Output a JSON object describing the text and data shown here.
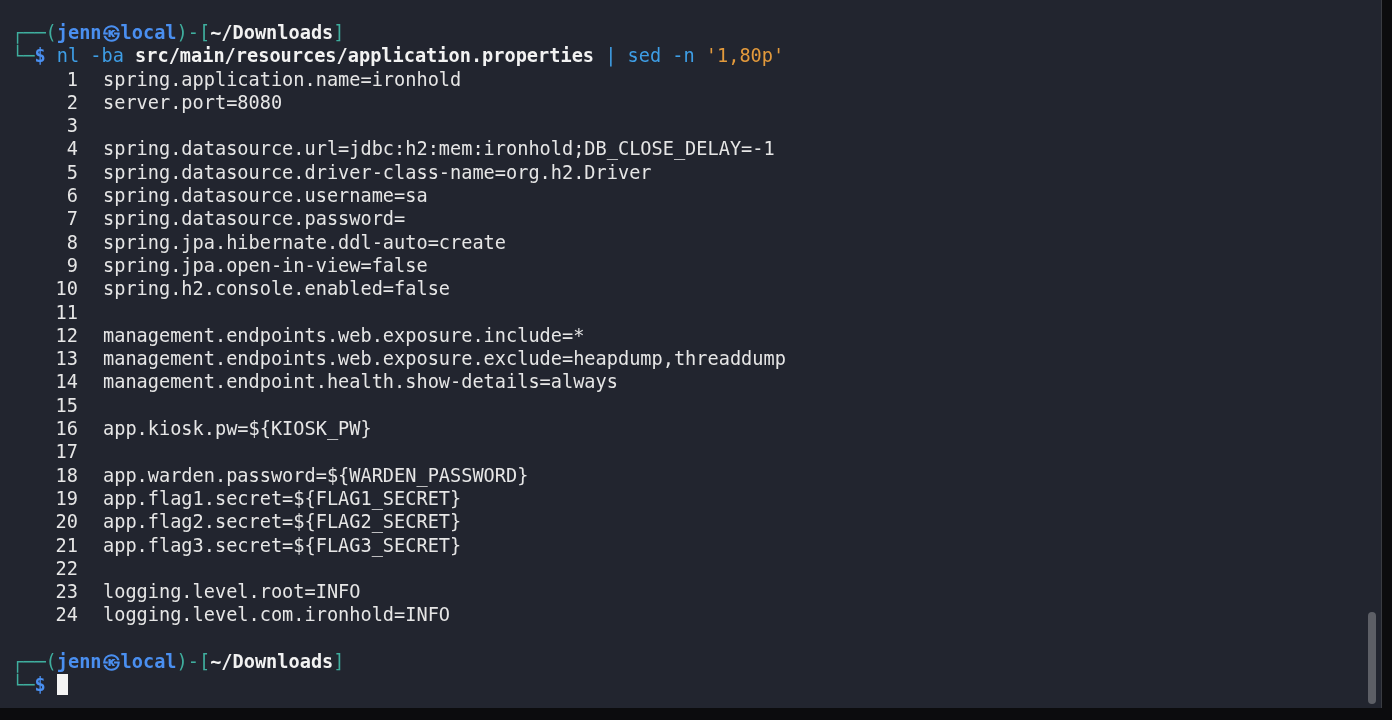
{
  "prompts": [
    {
      "open": "┌──(",
      "user": "jenn",
      "at": "㉿",
      "host": "local",
      "mid": ")-[",
      "path": "~/Downloads",
      "close": "]",
      "corner": "└─",
      "symbol": "$",
      "command": [
        {
          "kind": "cmd",
          "text": "nl"
        },
        {
          "kind": "flag",
          "text": "-ba"
        },
        {
          "kind": "path",
          "text": "src/main/resources/application.properties"
        },
        {
          "kind": "pipe",
          "text": "|"
        },
        {
          "kind": "cmd",
          "text": "sed"
        },
        {
          "kind": "flag",
          "text": "-n"
        },
        {
          "kind": "string",
          "text": "'1,80p'"
        }
      ]
    },
    {
      "open": "┌──(",
      "user": "jenn",
      "at": "㉿",
      "host": "local",
      "mid": ")-[",
      "path": "~/Downloads",
      "close": "]",
      "corner": "└─",
      "symbol": "$",
      "cursor": true
    }
  ],
  "output": [
    {
      "number": "1",
      "text": "spring.application.name=ironhold"
    },
    {
      "number": "2",
      "text": "server.port=8080"
    },
    {
      "number": "3"
    },
    {
      "number": "4",
      "text": "spring.datasource.url=jdbc:h2:mem:ironhold;DB_CLOSE_DELAY=-1"
    },
    {
      "number": "5",
      "text": "spring.datasource.driver-class-name=org.h2.Driver"
    },
    {
      "number": "6",
      "text": "spring.datasource.username=sa"
    },
    {
      "number": "7",
      "text": "spring.datasource.password="
    },
    {
      "number": "8",
      "text": "spring.jpa.hibernate.ddl-auto=create"
    },
    {
      "number": "9",
      "text": "spring.jpa.open-in-view=false"
    },
    {
      "number": "10",
      "text": "spring.h2.console.enabled=false"
    },
    {
      "number": "11"
    },
    {
      "number": "12",
      "text": "management.endpoints.web.exposure.include=*"
    },
    {
      "number": "13",
      "text": "management.endpoints.web.exposure.exclude=heapdump,threaddump"
    },
    {
      "number": "14",
      "text": "management.endpoint.health.show-details=always"
    },
    {
      "number": "15"
    },
    {
      "number": "16",
      "text": "app.kiosk.pw=${KIOSK_PW}"
    },
    {
      "number": "17"
    },
    {
      "number": "18",
      "text": "app.warden.password=${WARDEN_PASSWORD}"
    },
    {
      "number": "19",
      "text": "app.flag1.secret=${FLAG1_SECRET}"
    },
    {
      "number": "20",
      "text": "app.flag2.secret=${FLAG2_SECRET}"
    },
    {
      "number": "21",
      "text": "app.flag3.secret=${FLAG3_SECRET}"
    },
    {
      "number": "22"
    },
    {
      "number": "23",
      "text": "logging.level.root=INFO"
    },
    {
      "number": "24",
      "text": "logging.level.com.ironhold=INFO"
    }
  ]
}
